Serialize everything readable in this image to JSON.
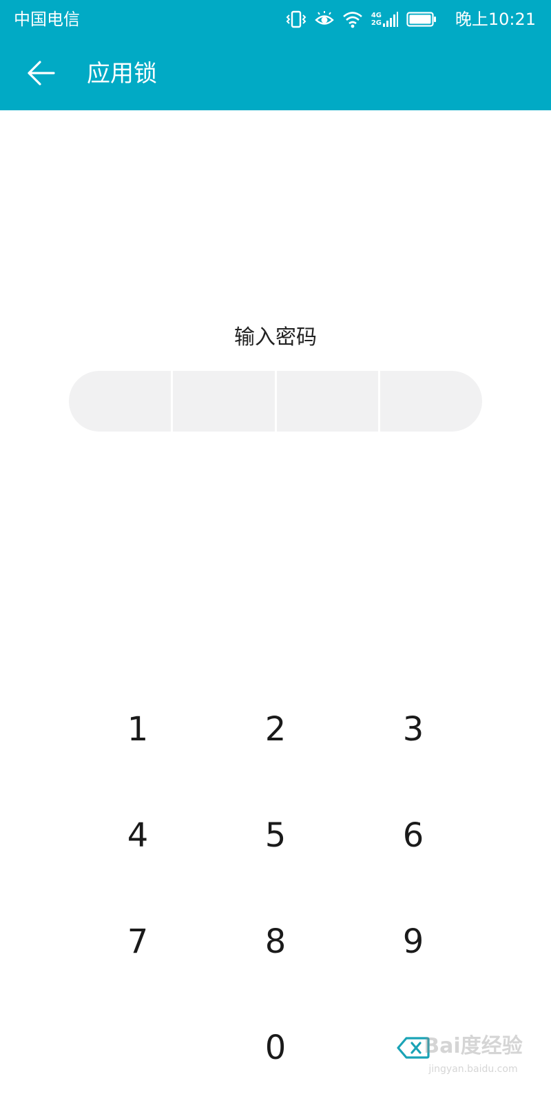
{
  "status_bar": {
    "carrier": "中国电信",
    "network_label_top": "4G",
    "network_label_bottom": "2G",
    "time": "晚上10:21",
    "icons": [
      "vibrate-icon",
      "eye-comfort-icon",
      "wifi-icon",
      "signal-icon",
      "battery-icon"
    ]
  },
  "app_bar": {
    "back_icon": "arrow-left-icon",
    "title": "应用锁"
  },
  "password": {
    "prompt": "输入密码",
    "digit_count": 4
  },
  "keypad": {
    "keys": [
      "1",
      "2",
      "3",
      "4",
      "5",
      "6",
      "7",
      "8",
      "9",
      "0"
    ],
    "delete_icon": "backspace-icon"
  },
  "watermark": {
    "main": "Bai度经验",
    "sub": "jingyan.baidu.com"
  },
  "colors": {
    "header_bg": "#01aac5",
    "accent": "#1aa3b6",
    "pin_box_bg": "#f1f1f2",
    "key_text": "#1a1a1a"
  }
}
